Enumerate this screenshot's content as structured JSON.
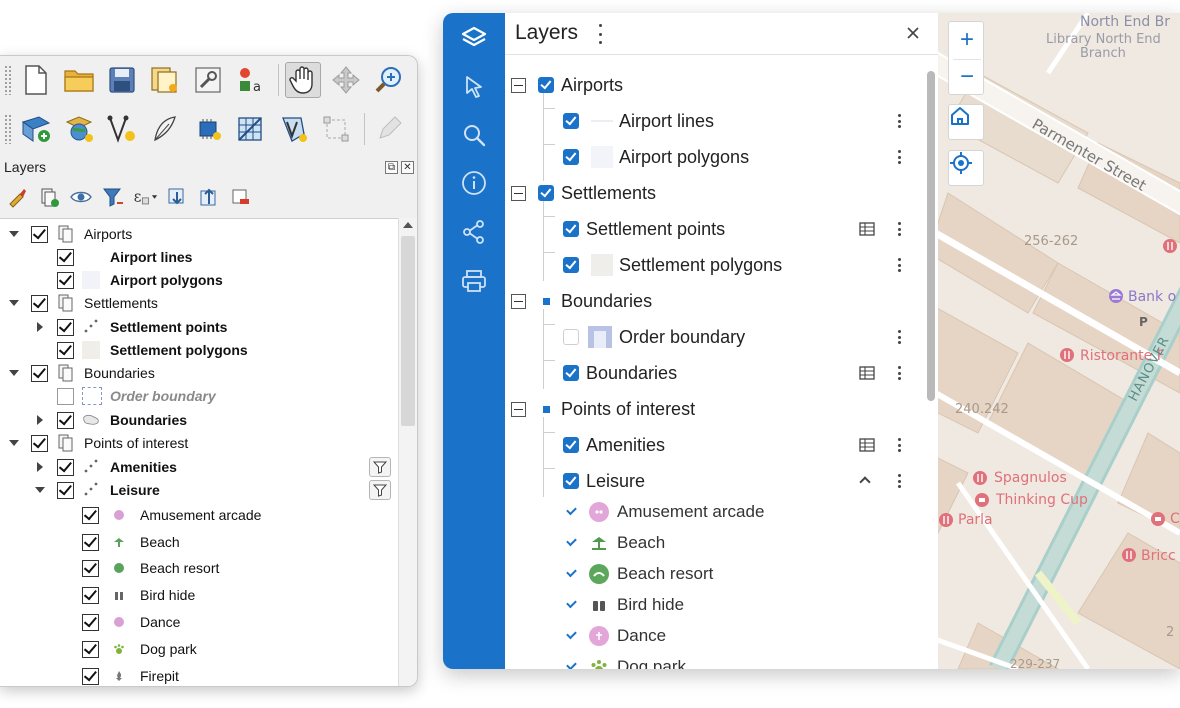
{
  "qgis": {
    "panel_title": "Layers",
    "dock_float": "⧉",
    "dock_close": "✕",
    "tree": [
      {
        "label": "Airports",
        "checked": true,
        "style": "normal"
      },
      {
        "label": "Airport lines",
        "checked": true,
        "style": "bold"
      },
      {
        "label": "Airport polygons",
        "checked": true,
        "style": "bold"
      },
      {
        "label": "Settlements",
        "checked": true,
        "style": "normal"
      },
      {
        "label": "Settlement points",
        "checked": true,
        "style": "bold"
      },
      {
        "label": "Settlement polygons",
        "checked": true,
        "style": "bold"
      },
      {
        "label": "Boundaries",
        "checked": true,
        "style": "normal"
      },
      {
        "label": "Order boundary",
        "checked": false,
        "style": "muted"
      },
      {
        "label": "Boundaries",
        "checked": true,
        "style": "bold"
      },
      {
        "label": "Points of interest",
        "checked": true,
        "style": "normal"
      },
      {
        "label": "Amenities",
        "checked": true,
        "style": "bold"
      },
      {
        "label": "Leisure",
        "checked": true,
        "style": "bold"
      },
      {
        "label": "Amusement arcade",
        "checked": true,
        "style": "normal"
      },
      {
        "label": "Beach",
        "checked": true,
        "style": "normal"
      },
      {
        "label": "Beach resort",
        "checked": true,
        "style": "normal"
      },
      {
        "label": "Bird hide",
        "checked": true,
        "style": "normal"
      },
      {
        "label": "Dance",
        "checked": true,
        "style": "normal"
      },
      {
        "label": "Dog park",
        "checked": true,
        "style": "normal"
      },
      {
        "label": "Firepit",
        "checked": true,
        "style": "normal"
      }
    ]
  },
  "web": {
    "title": "Layers",
    "close": "×",
    "tree": [
      {
        "label": "Airports"
      },
      {
        "label": "Airport lines"
      },
      {
        "label": "Airport polygons"
      },
      {
        "label": "Settlements"
      },
      {
        "label": "Settlement points"
      },
      {
        "label": "Settlement polygons"
      },
      {
        "label": "Boundaries"
      },
      {
        "label": "Order boundary"
      },
      {
        "label": "Boundaries"
      },
      {
        "label": "Points of interest"
      },
      {
        "label": "Amenities"
      },
      {
        "label": "Leisure"
      },
      {
        "label": "Amusement arcade"
      },
      {
        "label": "Beach"
      },
      {
        "label": "Beach resort"
      },
      {
        "label": "Bird hide"
      },
      {
        "label": "Dance"
      },
      {
        "label": "Dog park"
      }
    ],
    "map": {
      "labels": [
        "North End Br",
        "Library North End",
        "Branch",
        "Parmenter Street",
        "256-262",
        "Bank o",
        "Ristorante F",
        "240.242",
        "HANOVER",
        "Spagnulos",
        "Thinking Cup",
        "Parla",
        "C",
        "Bricc",
        "229-237",
        "2"
      ],
      "zoom_in": "+",
      "zoom_out": "−"
    },
    "colors": {
      "accent": "#1a73c9",
      "poi": "#e0707a",
      "map_bg": "#efe9e1"
    }
  }
}
